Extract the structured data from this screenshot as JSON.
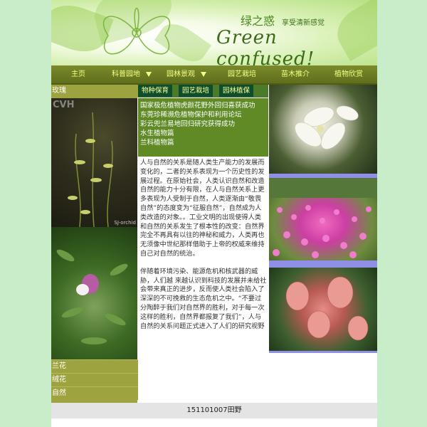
{
  "header": {
    "title_cn": "绿之惑",
    "tagline": "享受清新感觉",
    "title_en": "Green confused!"
  },
  "nav": {
    "items": [
      {
        "label": "主页",
        "has_dropdown": false
      },
      {
        "label": "科普园地",
        "has_dropdown": true
      },
      {
        "label": "园林景观",
        "has_dropdown": true
      },
      {
        "label": "园艺栽培",
        "has_dropdown": false
      },
      {
        "label": "苗木推介",
        "has_dropdown": false
      },
      {
        "label": "植物欣赏",
        "has_dropdown": false
      }
    ]
  },
  "sidebar": {
    "title": "玫瑰",
    "photo1_watermark_top": "CVH",
    "photo1_watermark_bottom": "SJ-orchid",
    "links": [
      "兰花",
      "绒花",
      "自然"
    ]
  },
  "main": {
    "tabs": [
      "物种保育",
      "园艺栽培",
      "园林植保"
    ],
    "news": [
      "国家极危植物虎颜花野外回归喜获成功",
      "东莞珍稀濒危植物保护和利用论坛",
      "彩云兜兰易地回归研究获得成功",
      "水生植物篇",
      "兰科植物篇"
    ],
    "paragraphs": [
      "人与自然的关系是随人类生产能力的发展而变化的，二者的关系表现为一个历史性的发展过程。在原始社会，人类认识自然和改造自然的能力十分有限，在人与自然关系上更多表现为人受制于自然，人类逐渐由“敬畏自然”的态度变为“征服自然”，自然成为人类改造的对象。。工业文明的出现使得人类和自然的关系发生了根本性的改变：自然界完全不再具有以往的神秘和威力，人类再也无须像中世纪那样借助于上帝的权威来维持自己对自然的统治。",
      "伴随着环境污染、能源危机和核武器的威胁，人们越 来越认识到科技的发展并未给社会带来真正的进步，反而使人类社会陷入了深深的不可挽救的生态危机之中。“不要过分陶醉于我们对自然界的胜利，对于每一次这样的胜利，自然界都报复了我们”，人与自然的关系问题正式进入了人们的研究视野"
    ]
  },
  "footer": {
    "text": "151101007田野"
  }
}
